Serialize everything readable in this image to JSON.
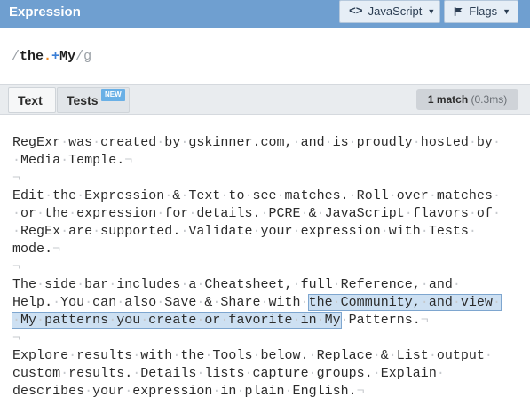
{
  "header": {
    "title": "Expression",
    "language_button": "JavaScript",
    "flags_button": "Flags"
  },
  "expression": {
    "open_slash": "/",
    "part1": "the",
    "dot": ".",
    "plus": "+",
    "part2": "My",
    "close_slash": "/",
    "flags": "g"
  },
  "tabs": {
    "text_label": "Text",
    "tests_label": "Tests",
    "new_badge": "NEW",
    "match_count": "1 match",
    "match_time": "(0.3ms)"
  },
  "text_lines": [
    "RegExr·was·created·by·gskinner.com,·and·is·proudly·hosted·by·",
    "·Media·Temple.¬",
    "¬",
    "Edit·the·Expression·&·Text·to·see·matches.·Roll·over·matches·",
    "·or·the·expression·for·details.·PCRE·&·JavaScript·flavors·of·",
    "·RegEx·are·supported.·Validate·your·expression·with·Tests·",
    "mode.¬",
    "¬",
    "The·side·bar·includes·a·Cheatsheet,·full·Reference,·and·",
    "Help.·You·can·also·Save·&·Share·with·",
    "·My·patterns·you·create·or·favorite·in·My",
    "¬",
    "Explore·results·with·the·Tools·below.·Replace·&·List·output·",
    "custom·results.·Details·lists·capture·groups.·Explain·",
    "describes·your·expression·in·plain·English.¬"
  ],
  "highlight": {
    "line10_match": "the·Community,·and·view·",
    "line11_after": "·Patterns.¬"
  },
  "colors": {
    "header_bg": "#6f9fd0",
    "match_highlight": "#cde0f2",
    "dot_token": "#f08a24",
    "plus_token": "#3a7ed6"
  }
}
